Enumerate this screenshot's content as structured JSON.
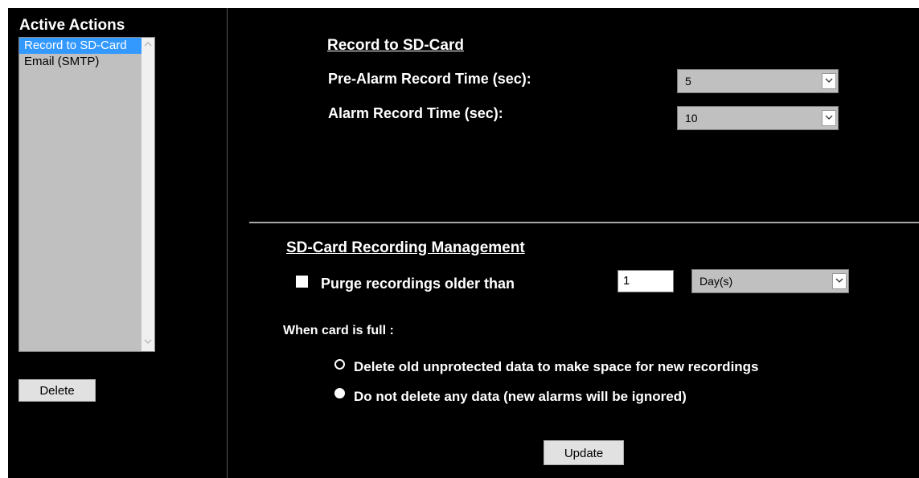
{
  "sidebar": {
    "title": "Active Actions",
    "items": [
      {
        "label": "Record to SD-Card",
        "selected": true
      },
      {
        "label": "Email (SMTP)",
        "selected": false
      }
    ],
    "delete_label": "Delete"
  },
  "record_section": {
    "title": "Record to SD-Card",
    "pre_alarm_label": "Pre-Alarm Record Time (sec):",
    "pre_alarm_value": "5",
    "alarm_label": "Alarm Record Time (sec):",
    "alarm_value": "10"
  },
  "management": {
    "title": "SD-Card Recording Management",
    "purge_checked": false,
    "purge_label": "Purge recordings older than",
    "purge_amount": "1",
    "purge_unit": "Day(s)",
    "full_label": "When card is full :",
    "options": [
      {
        "label": "Delete old unprotected data to make space for new recordings",
        "checked": false
      },
      {
        "label": "Do not delete any data (new alarms will be ignored)",
        "checked": true
      }
    ],
    "update_label": "Update"
  },
  "icons": {
    "scroll_up": "chevron-up-icon",
    "scroll_down": "chevron-down-icon",
    "dropdown": "chevron-down-icon"
  }
}
